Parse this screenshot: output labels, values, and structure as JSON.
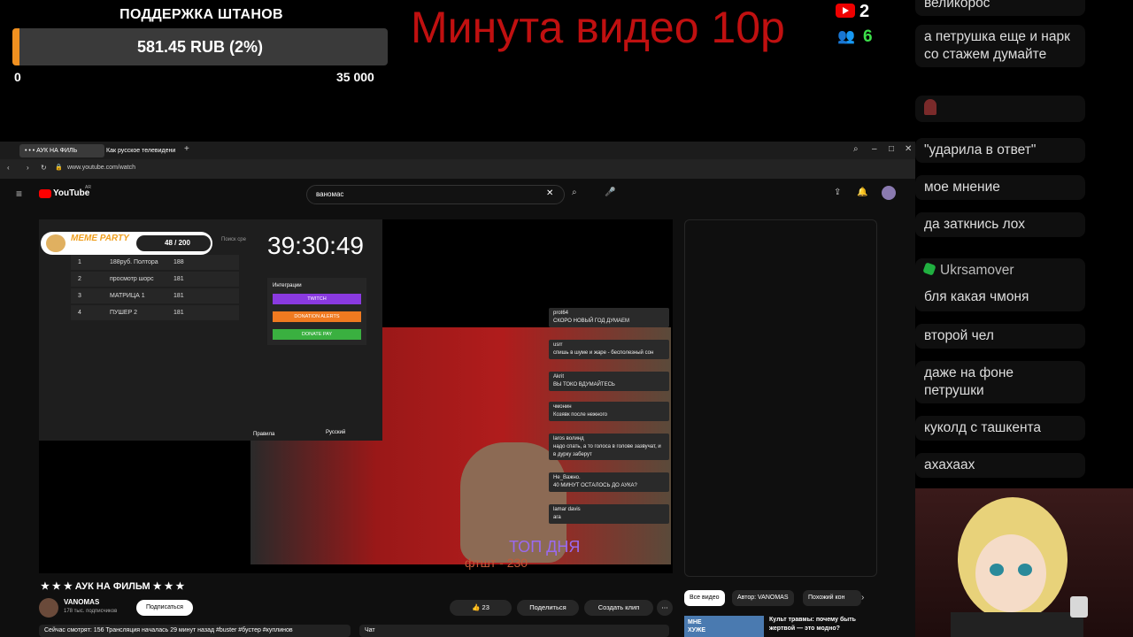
{
  "overlay": {
    "support_title": "ПОДДЕРЖКА ШТАНОВ",
    "support_amount": "581.45 RUB (2%)",
    "support_progress": 0.02,
    "support_min": "0",
    "support_max": "35 000",
    "promo_text": "Минута видео 10р",
    "youtube_count": "2",
    "viewers_count": "6",
    "accent_color": "#f09020",
    "promo_color": "#c01010"
  },
  "chat": {
    "messages": [
      {
        "name": "",
        "text": "великорос"
      },
      {
        "name": "",
        "text": "а петрушка еще и нарк со стажем думайте"
      },
      {
        "name": "",
        "text": ""
      },
      {
        "name": "",
        "text": "\"ударила в ответ\""
      },
      {
        "name": "",
        "text": "мое мнение"
      },
      {
        "name": "",
        "text": "да заткнись лох"
      },
      {
        "name": "Ukrsamover",
        "text": "бля какая чмоня"
      },
      {
        "name": "",
        "text": "второй чел"
      },
      {
        "name": "",
        "text": "даже на фоне петрушки"
      },
      {
        "name": "",
        "text": "куколд с ташкента"
      },
      {
        "name": "",
        "text": "ахахаах"
      }
    ]
  },
  "browser": {
    "tabs": [
      "• • • АУК НА ФИЛЬ",
      "Как русское телевидени"
    ],
    "url": "www.youtube.com/watch",
    "logo": "YouTube",
    "logo_suffix": "AR",
    "search_value": "ваномас"
  },
  "auction": {
    "meme_party": "MEME PARTY",
    "counter": "48 / 200",
    "search_placeholder": "Поиск сре",
    "timer": "39:30:49",
    "lots": [
      {
        "num": "1",
        "name": "188руб. Полтора",
        "value": "188"
      },
      {
        "num": "2",
        "name": "просмотр шорс",
        "value": "181"
      },
      {
        "num": "3",
        "name": "МАТРИЦА 1",
        "value": "181"
      },
      {
        "num": "4",
        "name": "ПУШЕР 2",
        "value": "181"
      }
    ],
    "integration_label": "Интеграции",
    "twitch_label": "TWITCH",
    "donation_label": "DONATION ALERTS",
    "donatepay_label": "DONATE PAY",
    "rules_label": "Правила",
    "lang_label": "Русский"
  },
  "stream_chat": [
    {
      "name": "prot64",
      "text": "СКОРО НОВЫЙ ГОД ДУМАЕМ"
    },
    {
      "name": "usrr",
      "text": "спишь в шуме и жаре - бесполезный сон"
    },
    {
      "name": "Akrit",
      "text": "ВЫ ТОКО ВДУМАЙТЕСЬ"
    },
    {
      "name": "чмонин",
      "text": "Козявк после нежного"
    },
    {
      "name": "laros волинд",
      "text": "надо спать, а то голоса в голове зазвучат, и в дурку заберут"
    },
    {
      "name": "Не_Важно.",
      "text": "40 МИНУТ ОСТАЛОСЬ ДО АУКА?"
    },
    {
      "name": "lamar davis",
      "text": "ага"
    }
  ],
  "stream_overlay": {
    "top_day": "ТОП ДНЯ",
    "ftsht": "фтшт - 230"
  },
  "video": {
    "title": "★ ★ ★ АУК НА ФИЛЬМ ★ ★ ★",
    "channel": "VANOMAS",
    "subscribers": "178 тыс. подписчиков",
    "subscribe_label": "Подписаться",
    "likes": "23",
    "share_label": "Поделиться",
    "clip_label": "Создать клип",
    "live_info": "Сейчас смотрят: 156  Трансляция началась 29 минут назад  #buster #бустер #куплинов",
    "chat_label": "Чат"
  },
  "recommendations": {
    "chips": [
      "Все видео",
      "Автор: VANOMAS",
      "Похожий кон"
    ],
    "first_title": "Культ травмы: почему быть жертвой — это модно?",
    "first_thumb_text": "МНЕ ХУЖЕ"
  }
}
